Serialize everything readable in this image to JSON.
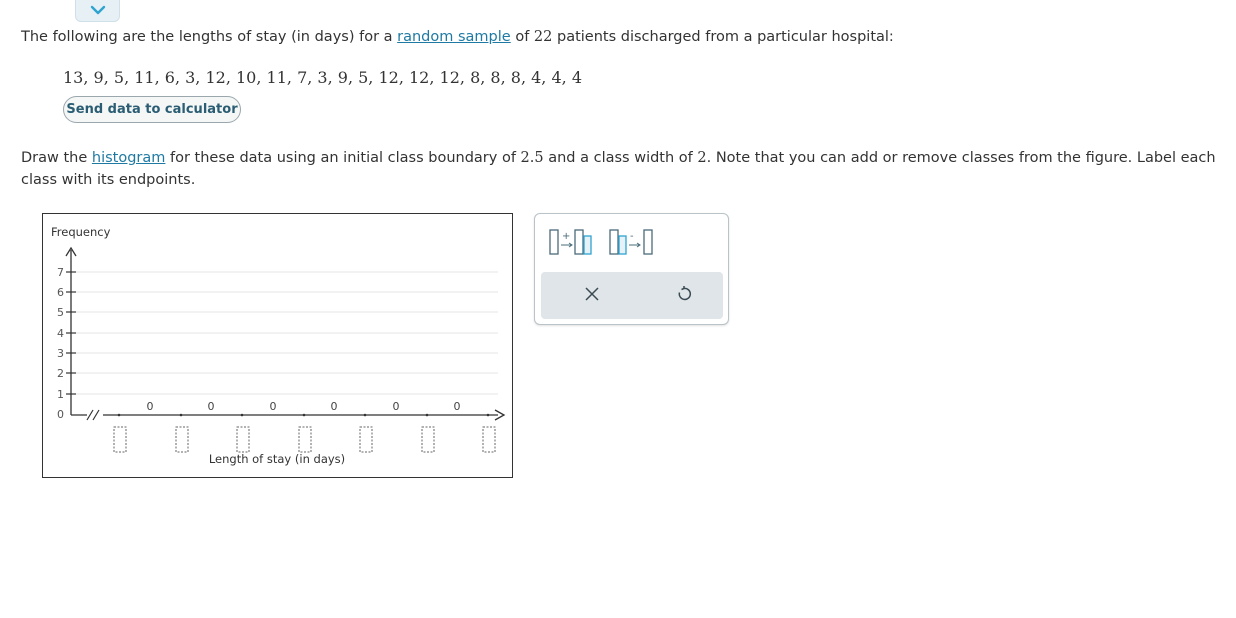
{
  "problem": {
    "intro_before": "The following are the lengths of stay (in days) for a ",
    "intro_link": "random sample",
    "intro_mid": " of ",
    "intro_n": "22",
    "intro_after": " patients discharged from a particular hospital:",
    "data_values": "13, 9, 5, 11, 6, 3, 12, 10, 11, 7, 3, 9, 5, 12, 12, 12, 8, 8, 8, 4, 4, 4",
    "send_button": "Send data to calculator",
    "instr_before": "Draw the ",
    "instr_link": "histogram",
    "instr_mid1": " for these data using an initial class boundary of ",
    "instr_boundary": "2.5",
    "instr_mid2": " and a class width of ",
    "instr_width": "2",
    "instr_after": ". Note that you can add or remove classes from the figure. Label each class with its endpoints."
  },
  "graph": {
    "y_axis_label": "Frequency",
    "x_axis_label": "Length of stay (in days)",
    "y_ticks": [
      "0",
      "1",
      "2",
      "3",
      "4",
      "5",
      "6",
      "7"
    ],
    "bar_counts": [
      "0",
      "0",
      "0",
      "0",
      "0",
      "0"
    ],
    "class_boundary_boxes": [
      "",
      "",
      "",
      "",
      "",
      "",
      ""
    ]
  },
  "toolbar": {
    "add_class_icon": "add-class-icon",
    "remove_class_icon": "remove-class-icon",
    "clear_icon": "close-icon",
    "undo_icon": "undo-icon"
  },
  "colors": {
    "link": "#1f7aa3",
    "accent_chevron": "#2fa4cf",
    "grid": "#e6e6e6",
    "toolbar_bar": "#dfe5e8"
  }
}
